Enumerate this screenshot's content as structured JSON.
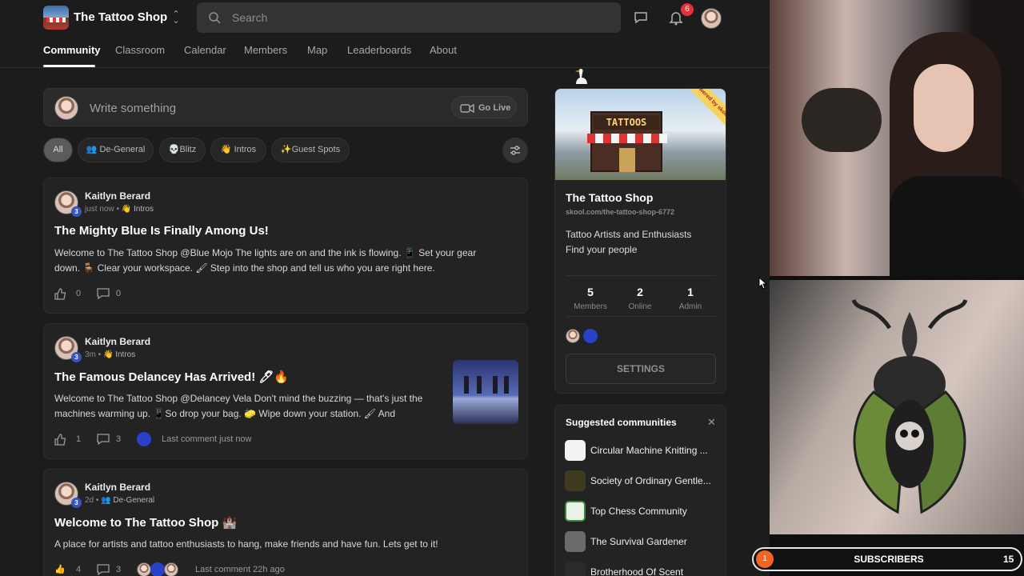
{
  "header": {
    "brand": "The Tattoo Shop",
    "search_placeholder": "Search",
    "notifications": "6"
  },
  "nav": {
    "tabs": [
      "Community",
      "Classroom",
      "Calendar",
      "Members",
      "Map",
      "Leaderboards",
      "About"
    ],
    "active": "Community"
  },
  "composer": {
    "placeholder": "Write something",
    "go_live": "Go Live"
  },
  "filters": [
    "All",
    "De-General",
    "Blitz",
    "Intros",
    "Guest Spots"
  ],
  "posts": [
    {
      "author": "Kaitlyn Berard",
      "level": "3",
      "time": "just now",
      "category": "Intros",
      "title": "The Mighty Blue Is Finally Among Us!",
      "line1": "Welcome to The Tattoo Shop @Blue Mojo The lights are on and the ink is flowing. 📱 Set your gear",
      "line2": "down. 🪑 Clear your workspace. 🖌 Step into the shop and tell us who you are right here.",
      "likes": "0",
      "comments": "0"
    },
    {
      "author": "Kaitlyn Berard",
      "level": "3",
      "time": "3m",
      "category": "Intros",
      "title": "The Famous Delancey Has Arrived! 🖊🔥",
      "line1": "Welcome to The Tattoo Shop @Delancey Vela Don't mind the buzzing — that's just the",
      "line2": "machines warming up. 📱So drop your bag. 🧽 Wipe down your station. 🖌 And",
      "likes": "1",
      "comments": "3",
      "last_comment": "Last comment just now"
    },
    {
      "author": "Kaitlyn Berard",
      "level": "3",
      "time": "2d",
      "category": "De-General",
      "title": "Welcome to The Tattoo Shop 🏰",
      "line1": "A place for artists and tattoo enthusiasts to hang, make friends and have fun. Lets get to it!",
      "likes": "4",
      "comments": "3",
      "last_comment": "Last comment 22h ago"
    }
  ],
  "group": {
    "banner_sign": "TATTOOS",
    "ribbon": "powered by skool",
    "name": "The Tattoo Shop",
    "url": "skool.com/the-tattoo-shop-6772",
    "desc1": "Tattoo Artists and Enthusiasts",
    "desc2": "Find your people",
    "stats": [
      {
        "n": "5",
        "l": "Members"
      },
      {
        "n": "2",
        "l": "Online"
      },
      {
        "n": "1",
        "l": "Admin"
      }
    ],
    "settings": "SETTINGS"
  },
  "suggested": {
    "heading": "Suggested communities",
    "items": [
      "Circular Machine Knitting ...",
      "Society of Ordinary Gentle...",
      "Top Chess Community",
      "The Survival Gardener",
      "Brotherhood Of Scent"
    ]
  },
  "stream": {
    "subs_count_left": "1",
    "subs_label": "SUBSCRIBERS",
    "subs_count_right": "15"
  },
  "colors": {
    "bg": "#1c1c1c",
    "card": "#232324",
    "badge": "#e3323c",
    "level": "#3454c7",
    "subs_dot": "#f26522"
  }
}
